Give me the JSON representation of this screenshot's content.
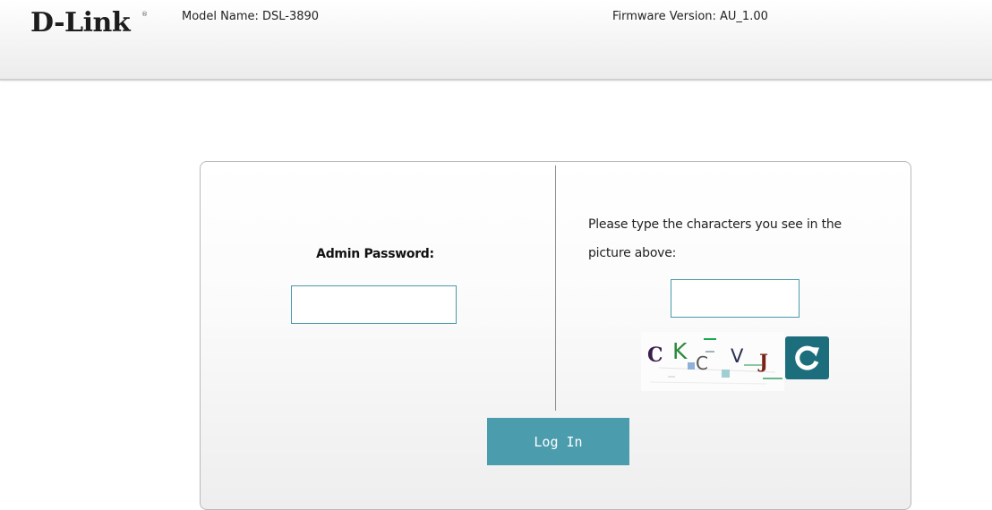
{
  "header": {
    "brand": "D-Link",
    "brand_mark": "®",
    "model_name": "Model Name: DSL-3890",
    "firmware_version": "Firmware Version: AU_1.00"
  },
  "login": {
    "password_label": "Admin Password:",
    "password_value": "",
    "captcha_instruction": "Please type the characters you see in the picture above:",
    "captcha_value": "",
    "captcha_characters": [
      "C",
      "K",
      "C",
      "V",
      "J"
    ],
    "refresh_icon": "refresh-icon",
    "login_label": "Log In"
  },
  "colors": {
    "accent": "#4b9cad",
    "refresh": "#1d6e7d",
    "input_border": "#4a9aaa"
  }
}
